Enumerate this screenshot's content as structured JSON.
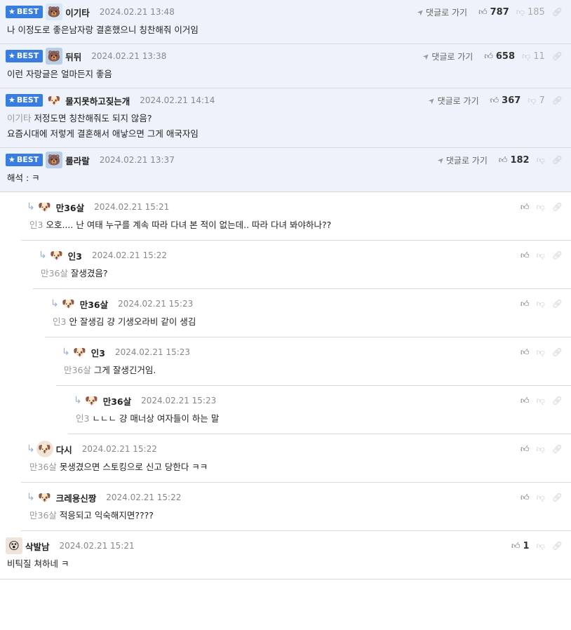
{
  "ui": {
    "best_label": "BEST",
    "goto_label": "댓글로 가기"
  },
  "comments": [
    {
      "id": "c1",
      "best": true,
      "depth": 0,
      "nick": "이기타",
      "avatar": "bear-icon",
      "date": "2024.02.21 13:48",
      "up": "787",
      "down": "185",
      "mention": "",
      "lines": [
        "나 이정도로 좋은남자랑 결혼했으니 칭찬해줘 이거임"
      ]
    },
    {
      "id": "c2",
      "best": true,
      "depth": 0,
      "nick": "뒤뒤",
      "avatar": "blue-character-icon",
      "date": "2024.02.21 13:38",
      "up": "658",
      "down": "11",
      "mention": "",
      "lines": [
        "이런 자랑글은 얼마든지 좋음"
      ]
    },
    {
      "id": "c3",
      "best": true,
      "depth": 0,
      "nick": "물지못하고짖는개",
      "avatar": "dog-icon",
      "date": "2024.02.21 14:14",
      "up": "367",
      "down": "7",
      "mention": "이기타",
      "lines": [
        "저정도면 칭찬해줘도 되지 않음?",
        "요즘시대에 저렇게 결혼해서 애낳으면 그게 애국자임"
      ]
    },
    {
      "id": "c4",
      "best": true,
      "depth": 0,
      "nick": "룰라랄",
      "avatar": "blue-character-icon",
      "date": "2024.02.21 13:37",
      "up": "182",
      "down": "",
      "mention": "",
      "lines": [
        "해석 : ㅋ"
      ]
    },
    {
      "id": "c5",
      "best": false,
      "depth": 1,
      "nick": "만36살",
      "avatar": "dog-icon",
      "date": "2024.02.21 15:21",
      "up": "",
      "down": "",
      "mention": "인3",
      "lines": [
        "오호.... 난 여태 누구를 계속 따라 다녀 본 적이 없는데.. 따라 다녀 봐야하나??"
      ]
    },
    {
      "id": "c6",
      "best": false,
      "depth": 2,
      "nick": "인3",
      "avatar": "dog-icon",
      "date": "2024.02.21 15:22",
      "up": "",
      "down": "",
      "mention": "만36살",
      "lines": [
        "잘생겼음?"
      ]
    },
    {
      "id": "c7",
      "best": false,
      "depth": 3,
      "nick": "만36살",
      "avatar": "dog-icon",
      "date": "2024.02.21 15:23",
      "up": "",
      "down": "",
      "mention": "인3",
      "lines": [
        "안 잘생김 걍 기생오라비 같이 생김"
      ]
    },
    {
      "id": "c8",
      "best": false,
      "depth": 4,
      "nick": "인3",
      "avatar": "dog-icon",
      "date": "2024.02.21 15:23",
      "up": "",
      "down": "",
      "mention": "만36살",
      "lines": [
        "그게 잘생긴거임."
      ]
    },
    {
      "id": "c9",
      "best": false,
      "depth": 5,
      "nick": "만36살",
      "avatar": "dog-icon",
      "date": "2024.02.21 15:23",
      "up": "",
      "down": "",
      "mention": "인3",
      "lines": [
        "ㄴㄴㄴ 걍 매너상 여자들이 하는 말"
      ]
    },
    {
      "id": "c10",
      "best": false,
      "depth": 1,
      "nick": "다시",
      "avatar": "round-dog-icon",
      "date": "2024.02.21 15:22",
      "up": "",
      "down": "",
      "mention": "만36살",
      "lines": [
        "못생겼으면 스토킹으로 신고 당한다 ㅋㅋ"
      ]
    },
    {
      "id": "c11",
      "best": false,
      "depth": 1,
      "nick": "크레용신짱",
      "avatar": "dog-icon",
      "date": "2024.02.21 15:22",
      "up": "",
      "down": "",
      "mention": "만36살",
      "lines": [
        "적응되고 익숙해지면????"
      ]
    },
    {
      "id": "c12",
      "best": false,
      "depth": 0,
      "nick": "삭발남",
      "avatar": "ugly-face-icon",
      "date": "2024.02.21 15:21",
      "up": "1",
      "down": "",
      "mention": "",
      "lines": [
        "비틱질 쳐하네 ㅋ"
      ]
    }
  ]
}
